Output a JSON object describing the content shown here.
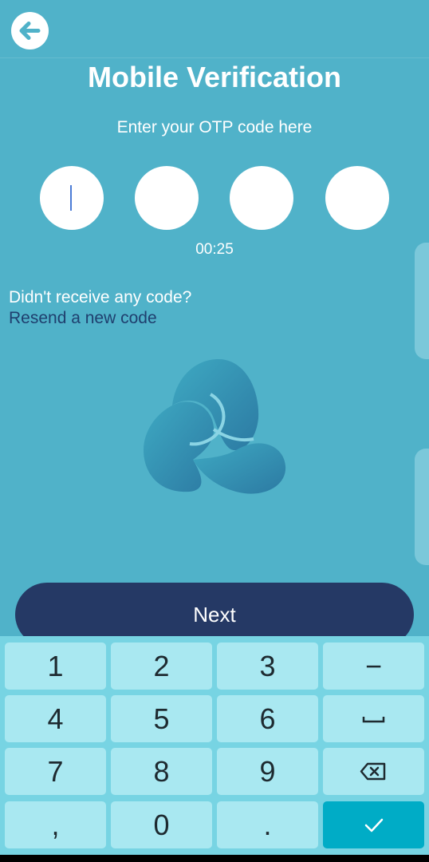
{
  "header": {
    "back_icon": "arrow-left-icon"
  },
  "title": "Mobile Verification",
  "subtitle": "Enter your OTP code here",
  "otp": {
    "digits": [
      "",
      "",
      "",
      ""
    ],
    "active_index": 0
  },
  "timer": "00:25",
  "no_code_text": "Didn't receive any code?",
  "resend_text": "Resend a new code",
  "logo_icon": "trefoil-logo-icon",
  "next_label": "Next",
  "keyboard": {
    "keys": [
      "1",
      "2",
      "3",
      "−",
      "4",
      "5",
      "6",
      "space",
      "7",
      "8",
      "9",
      "backspace",
      ",",
      "0",
      ".",
      "done"
    ]
  },
  "colors": {
    "background": "#50b2c9",
    "button": "#253965",
    "link": "#1f3f6e",
    "keyboard": "#77d4e3",
    "key": "#a9e8f1",
    "done_key": "#00acc6"
  }
}
